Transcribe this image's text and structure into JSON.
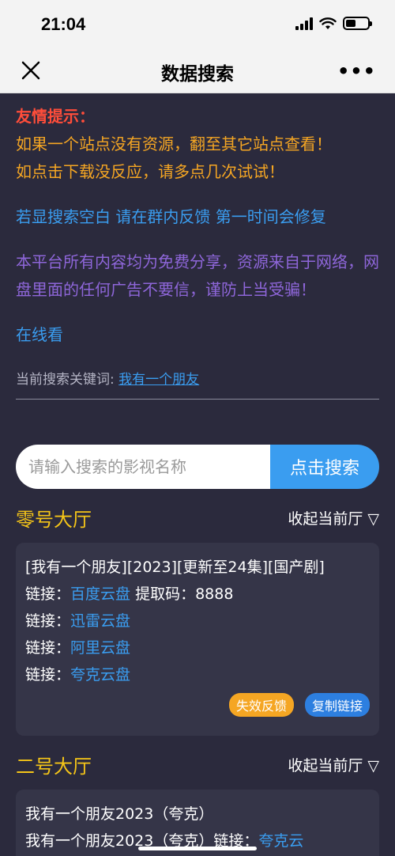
{
  "status": {
    "time": "21:04"
  },
  "nav": {
    "title": "数据搜索",
    "more": "•••"
  },
  "tips": {
    "title": "友情提示：",
    "line1": "如果一个站点没有资源，翻至其它站点查看！",
    "line2": "如点击下载没反应，请多点几次试试！"
  },
  "notice_blue": "若显搜索空白 请在群内反馈 第一时间会修复",
  "notice_purple": "本平台所有内容均为免费分享，资源来自于网络，网盘里面的任何广告不要信，谨防上当受骗！",
  "online_link": "在线看",
  "keyword": {
    "label": "当前搜索关键词: ",
    "value": "我有一个朋友"
  },
  "search": {
    "placeholder": "请输入搜索的影视名称",
    "button": "点击搜索"
  },
  "halls": [
    {
      "title": "零号大厅",
      "toggle": "收起当前厅 ▽",
      "card": {
        "title": "[我有一个朋友][2023][更新至24集][国产剧]",
        "links": [
          {
            "label": "链接：",
            "name": "百度云盘",
            "extra": " 提取码：8888"
          },
          {
            "label": "链接：",
            "name": "迅雷云盘",
            "extra": ""
          },
          {
            "label": "链接：",
            "name": "阿里云盘",
            "extra": ""
          },
          {
            "label": "链接：",
            "name": "夸克云盘",
            "extra": ""
          }
        ],
        "feedback": "失效反馈",
        "copy": "复制链接"
      }
    },
    {
      "title": "二号大厅",
      "toggle": "收起当前厅 ▽",
      "card": {
        "title": "我有一个朋友2023（夸克）",
        "line2_text": "我有一个朋友2023（夸克）链接：",
        "line2_link": "夸克云"
      }
    }
  ]
}
